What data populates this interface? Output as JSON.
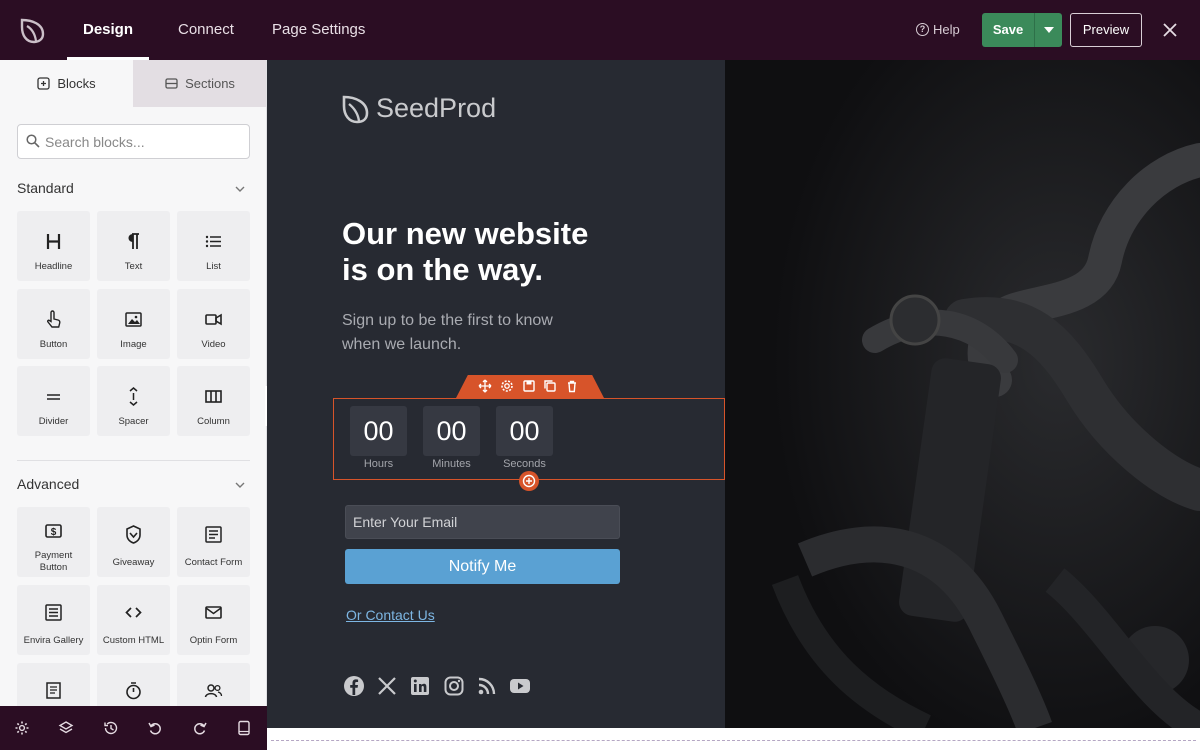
{
  "topbar": {
    "tabs": [
      "Design",
      "Connect",
      "Page Settings"
    ],
    "help_label": "Help",
    "save_label": "Save",
    "preview_label": "Preview"
  },
  "sidebar": {
    "tabs": [
      "Blocks",
      "Sections"
    ],
    "search_placeholder": "Search blocks...",
    "standard": {
      "title": "Standard",
      "blocks": [
        {
          "label": "Headline",
          "icon": "headline-icon"
        },
        {
          "label": "Text",
          "icon": "paragraph-icon"
        },
        {
          "label": "List",
          "icon": "list-icon"
        },
        {
          "label": "Button",
          "icon": "pointer-icon"
        },
        {
          "label": "Image",
          "icon": "image-icon"
        },
        {
          "label": "Video",
          "icon": "video-icon"
        },
        {
          "label": "Divider",
          "icon": "divider-icon"
        },
        {
          "label": "Spacer",
          "icon": "spacer-icon"
        },
        {
          "label": "Column",
          "icon": "column-icon"
        }
      ]
    },
    "advanced": {
      "title": "Advanced",
      "blocks": [
        {
          "label_line1": "Payment",
          "label_line2": "Button",
          "icon": "dollar-icon"
        },
        {
          "label": "Giveaway",
          "icon": "giveaway-icon"
        },
        {
          "label": "Contact Form",
          "icon": "form-icon"
        },
        {
          "label": "Envira Gallery",
          "icon": "gallery-icon"
        },
        {
          "label": "Custom HTML",
          "icon": "code-icon"
        },
        {
          "label": "Optin Form",
          "icon": "mail-icon"
        }
      ]
    }
  },
  "canvas": {
    "brand": "SeedProd",
    "headline_line1": "Our new website",
    "headline_line2": "is on the way.",
    "subtext_line1": "Sign up to be the first to know",
    "subtext_line2": "when we launch.",
    "countdown": [
      {
        "value": "00",
        "label": "Hours"
      },
      {
        "value": "00",
        "label": "Minutes"
      },
      {
        "value": "00",
        "label": "Seconds"
      }
    ],
    "email_placeholder": "Enter Your Email",
    "notify_label": "Notify Me",
    "contact_link": "Or Contact Us",
    "social_icons": [
      "facebook-icon",
      "x-twitter-icon",
      "linkedin-icon",
      "instagram-icon",
      "rss-icon",
      "youtube-icon"
    ]
  },
  "colors": {
    "topbar": "#2b0d23",
    "save": "#3b8a5a",
    "selection": "#d7542a",
    "notify": "#5aa1d3",
    "canvas": "#272a32"
  }
}
